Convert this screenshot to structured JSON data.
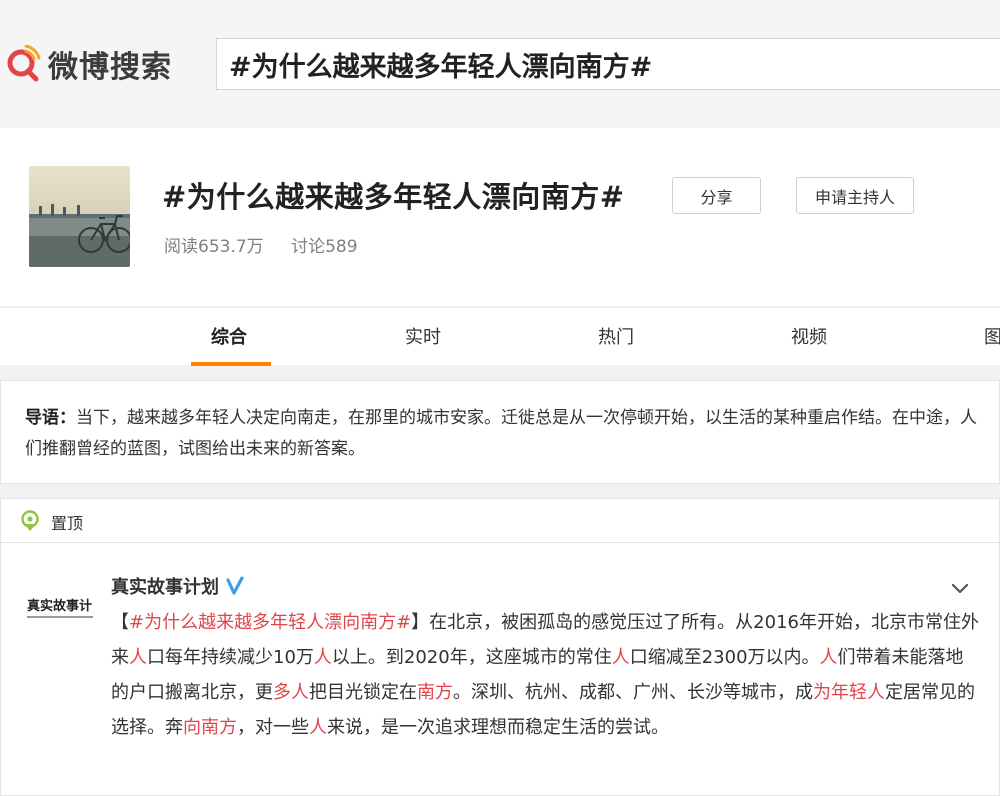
{
  "search": {
    "logo_text": "微博搜索",
    "query": "#为什么越来越多年轻人漂向南方#"
  },
  "topic": {
    "title": "#为什么越来越多年轻人漂向南方#",
    "reads": "阅读653.7万",
    "discussions": "讨论589",
    "share_label": "分享",
    "host_label": "申请主持人"
  },
  "tabs": [
    {
      "label": "综合",
      "active": true
    },
    {
      "label": "实时",
      "active": false
    },
    {
      "label": "热门",
      "active": false
    },
    {
      "label": "视频",
      "active": false
    },
    {
      "label": "图",
      "active": false
    }
  ],
  "intro": {
    "label": "导语：",
    "text": "当下，越来越多年轻人决定向南走，在那里的城市安家。迁徙总是从一次停顿开始，以生活的某种重启作结。在中途，人们推翻曾经的蓝图，试图给出未来的新答案。"
  },
  "pinned": {
    "label": "置顶"
  },
  "post": {
    "author": "真实故事计划",
    "avatar_text": "真实故事计",
    "segments": [
      {
        "t": "【",
        "hl": false
      },
      {
        "t": "#为什么越来越多年轻人漂向南方#",
        "hl": true
      },
      {
        "t": "】在北京，被困孤岛的感觉压过了所有。从2016年开始，北京市常住外来",
        "hl": false
      },
      {
        "t": "人",
        "hl": true
      },
      {
        "t": "口每年持续减少10万",
        "hl": false
      },
      {
        "t": "人",
        "hl": true
      },
      {
        "t": "以上。到2020年，这座城市的常住",
        "hl": false
      },
      {
        "t": "人",
        "hl": true
      },
      {
        "t": "口缩减至2300万以内。",
        "hl": false
      },
      {
        "t": "人",
        "hl": true
      },
      {
        "t": "们带着未能落地的户口搬离北京，更",
        "hl": false
      },
      {
        "t": "多人",
        "hl": true
      },
      {
        "t": "把目光锁定在",
        "hl": false
      },
      {
        "t": "南方",
        "hl": true
      },
      {
        "t": "。深圳、杭州、成都、广州、长沙等城市，成",
        "hl": false
      },
      {
        "t": "为年轻人",
        "hl": true
      },
      {
        "t": "定居常见的选择。奔",
        "hl": false
      },
      {
        "t": "向南方",
        "hl": true
      },
      {
        "t": "，对一些",
        "hl": false
      },
      {
        "t": "人",
        "hl": true
      },
      {
        "t": "来说，是一次追求理想而稳定生活的尝试。",
        "hl": false
      }
    ]
  },
  "colors": {
    "accent": "#ff8200",
    "highlight": "#e0454a",
    "logo_red": "#e0454a",
    "logo_orange": "#f5a623",
    "verified_blue": "#3a9ee8"
  }
}
